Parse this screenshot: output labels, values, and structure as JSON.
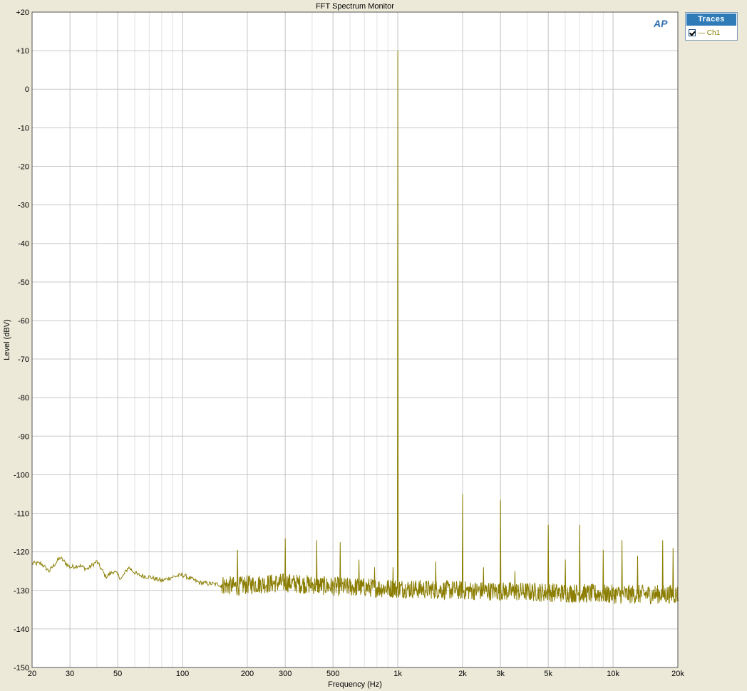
{
  "window": {
    "title": "FFT Spectrum Monitor"
  },
  "traces_panel": {
    "header": "Traces",
    "items": [
      {
        "label": "— Ch1",
        "checked": true,
        "color": "#8a7d00"
      }
    ]
  },
  "logo": "AP",
  "chart_data": {
    "type": "line",
    "title": "FFT Spectrum Monitor",
    "xlabel": "Frequency (Hz)",
    "ylabel": "Level (dBV)",
    "xscale": "log",
    "xlim": [
      20,
      20000
    ],
    "ylim": [
      -150,
      20
    ],
    "grid": true,
    "x_ticks": [
      {
        "value": 20,
        "label": "20"
      },
      {
        "value": 30,
        "label": "30"
      },
      {
        "value": 50,
        "label": "50"
      },
      {
        "value": 100,
        "label": "100"
      },
      {
        "value": 200,
        "label": "200"
      },
      {
        "value": 300,
        "label": "300"
      },
      {
        "value": 500,
        "label": "500"
      },
      {
        "value": 1000,
        "label": "1k"
      },
      {
        "value": 2000,
        "label": "2k"
      },
      {
        "value": 3000,
        "label": "3k"
      },
      {
        "value": 5000,
        "label": "5k"
      },
      {
        "value": 10000,
        "label": "10k"
      },
      {
        "value": 20000,
        "label": "20k"
      }
    ],
    "y_ticks": [
      {
        "value": 20,
        "label": "+20"
      },
      {
        "value": 10,
        "label": "+10"
      },
      {
        "value": 0,
        "label": "0"
      },
      {
        "value": -10,
        "label": "-10"
      },
      {
        "value": -20,
        "label": "-20"
      },
      {
        "value": -30,
        "label": "-30"
      },
      {
        "value": -40,
        "label": "-40"
      },
      {
        "value": -50,
        "label": "-50"
      },
      {
        "value": -60,
        "label": "-60"
      },
      {
        "value": -70,
        "label": "-70"
      },
      {
        "value": -80,
        "label": "-80"
      },
      {
        "value": -90,
        "label": "-90"
      },
      {
        "value": -100,
        "label": "-100"
      },
      {
        "value": -110,
        "label": "-110"
      },
      {
        "value": -120,
        "label": "-120"
      },
      {
        "value": -130,
        "label": "-130"
      },
      {
        "value": -140,
        "label": "-140"
      },
      {
        "value": -150,
        "label": "-150"
      }
    ],
    "series": [
      {
        "name": "Ch1",
        "color": "#8a7d00",
        "noise_floor": [
          [
            20,
            -123
          ],
          [
            22,
            -123
          ],
          [
            24,
            -125
          ],
          [
            27,
            -121.5
          ],
          [
            30,
            -124
          ],
          [
            33,
            -123.5
          ],
          [
            36,
            -124.5
          ],
          [
            40,
            -122.5
          ],
          [
            44,
            -126.5
          ],
          [
            48,
            -125
          ],
          [
            52,
            -127
          ],
          [
            56,
            -124
          ],
          [
            62,
            -126
          ],
          [
            70,
            -126.5
          ],
          [
            80,
            -127.5
          ],
          [
            90,
            -126.5
          ],
          [
            100,
            -126
          ],
          [
            120,
            -128
          ],
          [
            150,
            -128.5
          ],
          [
            180,
            -129
          ],
          [
            200,
            -128.5
          ],
          [
            300,
            -128
          ],
          [
            500,
            -129
          ],
          [
            1000,
            -129.5
          ],
          [
            2000,
            -130
          ],
          [
            5000,
            -130.5
          ],
          [
            10000,
            -131
          ],
          [
            20000,
            -131
          ]
        ],
        "noise_amplitude_db": 2.5,
        "peaks": [
          {
            "x": 180,
            "y": -119.5
          },
          {
            "x": 300,
            "y": -116.5
          },
          {
            "x": 420,
            "y": -117
          },
          {
            "x": 540,
            "y": -117.5
          },
          {
            "x": 660,
            "y": -122
          },
          {
            "x": 780,
            "y": -124
          },
          {
            "x": 950,
            "y": -124
          },
          {
            "x": 1000,
            "y": 10
          },
          {
            "x": 1500,
            "y": -122.5
          },
          {
            "x": 2000,
            "y": -105
          },
          {
            "x": 2500,
            "y": -124
          },
          {
            "x": 3000,
            "y": -106.5
          },
          {
            "x": 3500,
            "y": -125
          },
          {
            "x": 5000,
            "y": -113
          },
          {
            "x": 6000,
            "y": -122
          },
          {
            "x": 7000,
            "y": -113
          },
          {
            "x": 9000,
            "y": -119.5
          },
          {
            "x": 11000,
            "y": -117
          },
          {
            "x": 13000,
            "y": -121
          },
          {
            "x": 17000,
            "y": -117
          },
          {
            "x": 19000,
            "y": -119
          }
        ]
      }
    ]
  }
}
